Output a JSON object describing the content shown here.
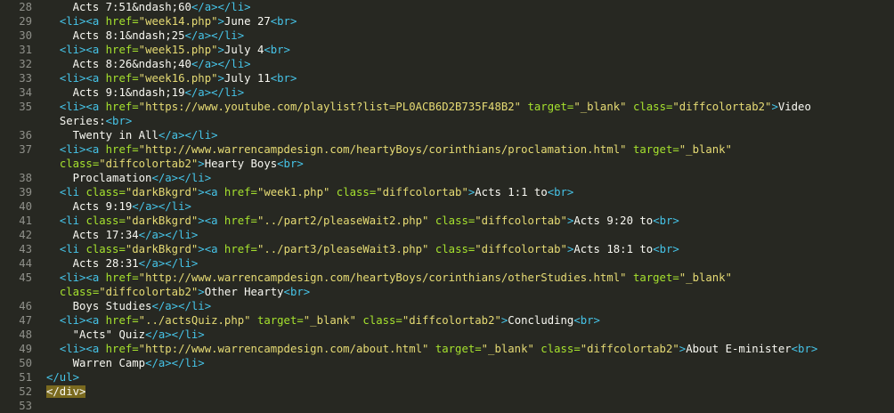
{
  "editor": {
    "lines": [
      {
        "num": "28",
        "indent": "    ",
        "segs": [
          {
            "k": "txt",
            "t": "Acts 7:51&ndash;60"
          },
          {
            "k": "tag",
            "t": "</a></li>"
          }
        ]
      },
      {
        "num": "29",
        "indent": "  ",
        "segs": [
          {
            "k": "tag",
            "t": "<li><a "
          },
          {
            "k": "attr",
            "t": "href="
          },
          {
            "k": "str",
            "t": "\"week14.php\""
          },
          {
            "k": "tag",
            "t": ">"
          },
          {
            "k": "txt",
            "t": "June 27"
          },
          {
            "k": "tag",
            "t": "<br>"
          }
        ]
      },
      {
        "num": "30",
        "indent": "    ",
        "segs": [
          {
            "k": "txt",
            "t": "Acts 8:1&ndash;25"
          },
          {
            "k": "tag",
            "t": "</a></li>"
          }
        ]
      },
      {
        "num": "31",
        "indent": "  ",
        "segs": [
          {
            "k": "tag",
            "t": "<li><a "
          },
          {
            "k": "attr",
            "t": "href="
          },
          {
            "k": "str",
            "t": "\"week15.php\""
          },
          {
            "k": "tag",
            "t": ">"
          },
          {
            "k": "txt",
            "t": "July 4"
          },
          {
            "k": "tag",
            "t": "<br>"
          }
        ]
      },
      {
        "num": "32",
        "indent": "    ",
        "segs": [
          {
            "k": "txt",
            "t": "Acts 8:26&ndash;40"
          },
          {
            "k": "tag",
            "t": "</a></li>"
          }
        ]
      },
      {
        "num": "33",
        "indent": "  ",
        "segs": [
          {
            "k": "tag",
            "t": "<li><a "
          },
          {
            "k": "attr",
            "t": "href="
          },
          {
            "k": "str",
            "t": "\"week16.php\""
          },
          {
            "k": "tag",
            "t": ">"
          },
          {
            "k": "txt",
            "t": "July 11"
          },
          {
            "k": "tag",
            "t": "<br>"
          }
        ]
      },
      {
        "num": "34",
        "indent": "    ",
        "segs": [
          {
            "k": "txt",
            "t": "Acts 9:1&ndash;19"
          },
          {
            "k": "tag",
            "t": "</a></li>"
          }
        ]
      },
      {
        "num": "35",
        "indent": "  ",
        "segs": [
          {
            "k": "tag",
            "t": "<li><a "
          },
          {
            "k": "attr",
            "t": "href="
          },
          {
            "k": "str",
            "t": "\"https://www.youtube.com/playlist?list=PL0ACB6D2B735F48B2\""
          },
          {
            "k": "txt",
            "t": " "
          },
          {
            "k": "attr",
            "t": "target="
          },
          {
            "k": "str",
            "t": "\"_blank\""
          },
          {
            "k": "txt",
            "t": " "
          },
          {
            "k": "attr",
            "t": "class="
          },
          {
            "k": "str",
            "t": "\"diffcolortab2\""
          },
          {
            "k": "tag",
            "t": ">"
          },
          {
            "k": "txt",
            "t": "Video"
          }
        ]
      },
      {
        "num": "",
        "indent": "  ",
        "segs": [
          {
            "k": "txt",
            "t": "Series:"
          },
          {
            "k": "tag",
            "t": "<br>"
          }
        ]
      },
      {
        "num": "36",
        "indent": "    ",
        "segs": [
          {
            "k": "txt",
            "t": "Twenty in All"
          },
          {
            "k": "tag",
            "t": "</a></li>"
          }
        ]
      },
      {
        "num": "37",
        "indent": "  ",
        "segs": [
          {
            "k": "tag",
            "t": "<li><a "
          },
          {
            "k": "attr",
            "t": "href="
          },
          {
            "k": "str",
            "t": "\"http://www.warrencampdesign.com/heartyBoys/corinthians/proclamation.html\""
          },
          {
            "k": "txt",
            "t": " "
          },
          {
            "k": "attr",
            "t": "target="
          },
          {
            "k": "str",
            "t": "\"_blank\""
          }
        ]
      },
      {
        "num": "",
        "indent": "  ",
        "segs": [
          {
            "k": "attr",
            "t": "class="
          },
          {
            "k": "str",
            "t": "\"diffcolortab2\""
          },
          {
            "k": "tag",
            "t": ">"
          },
          {
            "k": "txt",
            "t": "Hearty Boys"
          },
          {
            "k": "tag",
            "t": "<br>"
          }
        ]
      },
      {
        "num": "38",
        "indent": "    ",
        "segs": [
          {
            "k": "txt",
            "t": "Proclamation"
          },
          {
            "k": "tag",
            "t": "</a></li>"
          }
        ]
      },
      {
        "num": "39",
        "indent": "  ",
        "segs": [
          {
            "k": "tag",
            "t": "<li "
          },
          {
            "k": "attr",
            "t": "class="
          },
          {
            "k": "str",
            "t": "\"darkBkgrd\""
          },
          {
            "k": "tag",
            "t": "><a "
          },
          {
            "k": "attr",
            "t": "href="
          },
          {
            "k": "str",
            "t": "\"week1.php\""
          },
          {
            "k": "txt",
            "t": " "
          },
          {
            "k": "attr",
            "t": "class="
          },
          {
            "k": "str",
            "t": "\"diffcolortab\""
          },
          {
            "k": "tag",
            "t": ">"
          },
          {
            "k": "txt",
            "t": "Acts 1:1 to"
          },
          {
            "k": "tag",
            "t": "<br>"
          }
        ]
      },
      {
        "num": "40",
        "indent": "    ",
        "segs": [
          {
            "k": "txt",
            "t": "Acts 9:19"
          },
          {
            "k": "tag",
            "t": "</a></li>"
          }
        ]
      },
      {
        "num": "41",
        "indent": "  ",
        "segs": [
          {
            "k": "tag",
            "t": "<li "
          },
          {
            "k": "attr",
            "t": "class="
          },
          {
            "k": "str",
            "t": "\"darkBkgrd\""
          },
          {
            "k": "tag",
            "t": "><a "
          },
          {
            "k": "attr",
            "t": "href="
          },
          {
            "k": "str",
            "t": "\"../part2/pleaseWait2.php\""
          },
          {
            "k": "txt",
            "t": " "
          },
          {
            "k": "attr",
            "t": "class="
          },
          {
            "k": "str",
            "t": "\"diffcolortab\""
          },
          {
            "k": "tag",
            "t": ">"
          },
          {
            "k": "txt",
            "t": "Acts 9:20 to"
          },
          {
            "k": "tag",
            "t": "<br>"
          }
        ]
      },
      {
        "num": "42",
        "indent": "    ",
        "segs": [
          {
            "k": "txt",
            "t": "Acts 17:34"
          },
          {
            "k": "tag",
            "t": "</a></li>"
          }
        ]
      },
      {
        "num": "43",
        "indent": "  ",
        "segs": [
          {
            "k": "tag",
            "t": "<li "
          },
          {
            "k": "attr",
            "t": "class="
          },
          {
            "k": "str",
            "t": "\"darkBkgrd\""
          },
          {
            "k": "tag",
            "t": "><a "
          },
          {
            "k": "attr",
            "t": "href="
          },
          {
            "k": "str",
            "t": "\"../part3/pleaseWait3.php\""
          },
          {
            "k": "txt",
            "t": " "
          },
          {
            "k": "attr",
            "t": "class="
          },
          {
            "k": "str",
            "t": "\"diffcolortab\""
          },
          {
            "k": "tag",
            "t": ">"
          },
          {
            "k": "txt",
            "t": "Acts 18:1 to"
          },
          {
            "k": "tag",
            "t": "<br>"
          }
        ]
      },
      {
        "num": "44",
        "indent": "    ",
        "segs": [
          {
            "k": "txt",
            "t": "Acts 28:31"
          },
          {
            "k": "tag",
            "t": "</a></li>"
          }
        ]
      },
      {
        "num": "45",
        "indent": "  ",
        "segs": [
          {
            "k": "tag",
            "t": "<li><a "
          },
          {
            "k": "attr",
            "t": "href="
          },
          {
            "k": "str",
            "t": "\"http://www.warrencampdesign.com/heartyBoys/corinthians/otherStudies.html\""
          },
          {
            "k": "txt",
            "t": " "
          },
          {
            "k": "attr",
            "t": "target="
          },
          {
            "k": "str",
            "t": "\"_blank\""
          }
        ]
      },
      {
        "num": "",
        "indent": "  ",
        "segs": [
          {
            "k": "attr",
            "t": "class="
          },
          {
            "k": "str",
            "t": "\"diffcolortab2\""
          },
          {
            "k": "tag",
            "t": ">"
          },
          {
            "k": "txt",
            "t": "Other Hearty"
          },
          {
            "k": "tag",
            "t": "<br>"
          }
        ]
      },
      {
        "num": "46",
        "indent": "    ",
        "segs": [
          {
            "k": "txt",
            "t": "Boys Studies"
          },
          {
            "k": "tag",
            "t": "</a></li>"
          }
        ]
      },
      {
        "num": "47",
        "indent": "  ",
        "segs": [
          {
            "k": "tag",
            "t": "<li><a "
          },
          {
            "k": "attr",
            "t": "href="
          },
          {
            "k": "str",
            "t": "\"../actsQuiz.php\""
          },
          {
            "k": "txt",
            "t": " "
          },
          {
            "k": "attr",
            "t": "target="
          },
          {
            "k": "str",
            "t": "\"_blank\""
          },
          {
            "k": "txt",
            "t": " "
          },
          {
            "k": "attr",
            "t": "class="
          },
          {
            "k": "str",
            "t": "\"diffcolortab2\""
          },
          {
            "k": "tag",
            "t": ">"
          },
          {
            "k": "txt",
            "t": "Concluding"
          },
          {
            "k": "tag",
            "t": "<br>"
          }
        ]
      },
      {
        "num": "48",
        "indent": "    ",
        "segs": [
          {
            "k": "txt",
            "t": "\"Acts\" Quiz"
          },
          {
            "k": "tag",
            "t": "</a></li>"
          }
        ]
      },
      {
        "num": "49",
        "indent": "  ",
        "segs": [
          {
            "k": "tag",
            "t": "<li><a "
          },
          {
            "k": "attr",
            "t": "href="
          },
          {
            "k": "str",
            "t": "\"http://www.warrencampdesign.com/about.html\""
          },
          {
            "k": "txt",
            "t": " "
          },
          {
            "k": "attr",
            "t": "target="
          },
          {
            "k": "str",
            "t": "\"_blank\""
          },
          {
            "k": "txt",
            "t": " "
          },
          {
            "k": "attr",
            "t": "class="
          },
          {
            "k": "str",
            "t": "\"diffcolortab2\""
          },
          {
            "k": "tag",
            "t": ">"
          },
          {
            "k": "txt",
            "t": "About E-minister"
          },
          {
            "k": "tag",
            "t": "<br>"
          }
        ]
      },
      {
        "num": "50",
        "indent": "    ",
        "segs": [
          {
            "k": "txt",
            "t": "Warren Camp"
          },
          {
            "k": "tag",
            "t": "</a></li>"
          }
        ]
      },
      {
        "num": "51",
        "indent": "",
        "segs": [
          {
            "k": "tag",
            "t": "</ul>"
          }
        ]
      },
      {
        "num": "52",
        "indent": "",
        "segs": [
          {
            "k": "tag-hl",
            "t": "</div>"
          }
        ]
      },
      {
        "num": "53",
        "indent": "",
        "segs": []
      }
    ]
  }
}
